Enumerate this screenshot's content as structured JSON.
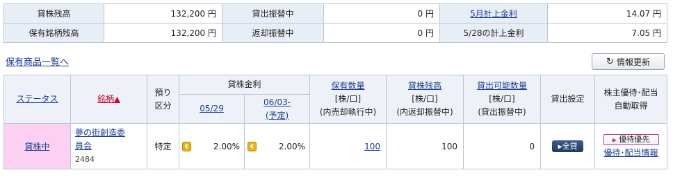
{
  "summary": {
    "rows": [
      [
        {
          "label": "貸株残高",
          "value": "132,200 円"
        },
        {
          "label": "貸出振替中",
          "value": "0 円"
        },
        {
          "label": "5月計上金利",
          "value": "14.07 円",
          "is_link": true
        }
      ],
      [
        {
          "label": "保有銘柄残高",
          "value": "132,200 円"
        },
        {
          "label": "返却振替中",
          "value": "0 円"
        },
        {
          "label": "5/28の計上金利",
          "value": "7.05 円"
        }
      ]
    ]
  },
  "holdings_link": "保有商品一覧へ",
  "refresh_button": {
    "icon": "refresh-icon",
    "label": "情報更新"
  },
  "table": {
    "headers": {
      "status": "ステータス",
      "name": "銘柄",
      "name_sort_arrow": "▲",
      "deposit_line1": "預り",
      "deposit_line2": "区分",
      "rate_group": "貸株金利",
      "rate_date1": "05/29",
      "rate_date2": "06/03-",
      "rate_date2_note": "(予定)",
      "holding_qty": "保有数量",
      "holding_unit": "[株/口]",
      "holding_note": "(内売却執行中)",
      "lending_balance": "貸株残高",
      "lending_unit": "[株/口]",
      "lending_note": "(内返却振替中)",
      "available": "貸出可能数量",
      "available_unit": "[株/口]",
      "available_note": "(貸出振替中)",
      "lending_setting": "貸出設定",
      "benefit_line1": "株主優待･配当",
      "benefit_line2": "自動取得"
    },
    "rows": [
      {
        "status": "貸株中",
        "name_line1": "夢の街創造委",
        "name_line2": "員会",
        "code": "2484",
        "deposit": "特定",
        "rate1_icon": "coin-icon",
        "rate1": "2.00%",
        "rate2_icon": "coin-icon",
        "rate2": "2.00%",
        "holding_qty": "100",
        "lending_balance": "100",
        "available": "0",
        "setting_button": "全貸",
        "benefit_button": "優待優先",
        "benefit_link": "優待･配当情報"
      }
    ]
  },
  "colors": {
    "label_bg": "#e8eef6",
    "header_bg": "#eef2f8",
    "border": "#b9c6d6",
    "link": "#1a3d99",
    "status_bg": "#fbd0f3",
    "sort_red": "#d0021b",
    "button_navy": "#1f3a63"
  }
}
